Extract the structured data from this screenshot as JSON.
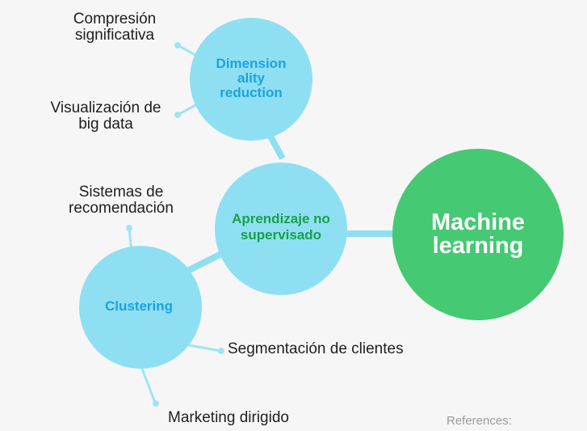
{
  "colors": {
    "background": "#f6f6f6",
    "light_circle": "#8fdff3",
    "connector": "#8fdff3",
    "dot": "#9fe4f5",
    "ml_circle": "#45c973",
    "green_text": "#16a34a",
    "blue_text": "#1aa3e0",
    "white_text": "#ffffff",
    "leaf_text": "#1f1f1f",
    "references_text": "#9a9a9a"
  },
  "nodes": {
    "machine_learning": {
      "line1": "Machine",
      "line2": "learning"
    },
    "unsupervised": {
      "line1": "Aprendizaje no",
      "line2": "supervisado"
    },
    "dimensionality": {
      "line1": "Dimension",
      "line2": "ality",
      "line3": "reduction"
    },
    "clustering": {
      "label": "Clustering"
    }
  },
  "leaves": {
    "compresion": {
      "line1": "Compresión",
      "line2": "significativa"
    },
    "visualizacion": {
      "line1": "Visualización de",
      "line2": "big data"
    },
    "sistemas": {
      "line1": "Sistemas de",
      "line2": "recomendación"
    },
    "segmentacion": {
      "label": "Segmentación de clientes"
    },
    "marketing": {
      "label": "Marketing dirigido"
    }
  },
  "footer": {
    "references": "References:"
  }
}
